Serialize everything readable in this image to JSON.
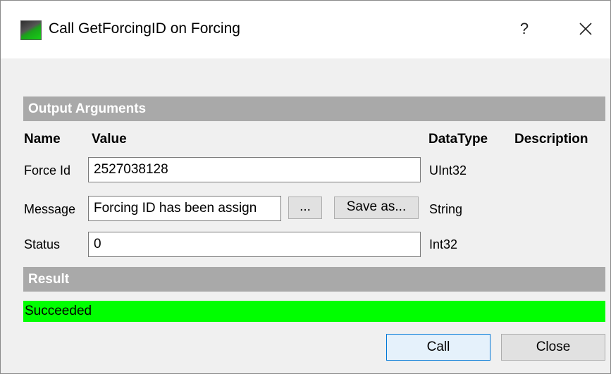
{
  "window": {
    "title": "Call GetForcingID on Forcing",
    "help_label": "?",
    "close_icon": "close-icon"
  },
  "output_section": {
    "header": "Output Arguments",
    "columns": {
      "name": "Name",
      "value": "Value",
      "datatype": "DataType",
      "description": "Description"
    },
    "rows": [
      {
        "name": "Force Id",
        "value": "2527038128",
        "datatype": "UInt32"
      },
      {
        "name": "Message",
        "value": "Forcing ID has been assign",
        "datatype": "String",
        "ellipsis_label": "...",
        "save_as_label": "Save as..."
      },
      {
        "name": "Status",
        "value": "0",
        "datatype": "Int32"
      }
    ]
  },
  "result_section": {
    "header": "Result",
    "status": "Succeeded",
    "status_color": "#00ff00"
  },
  "buttons": {
    "call": "Call",
    "close": "Close"
  },
  "colors": {
    "section_header_bg": "#a9a9a9",
    "primary_button_border": "#0078d7"
  }
}
